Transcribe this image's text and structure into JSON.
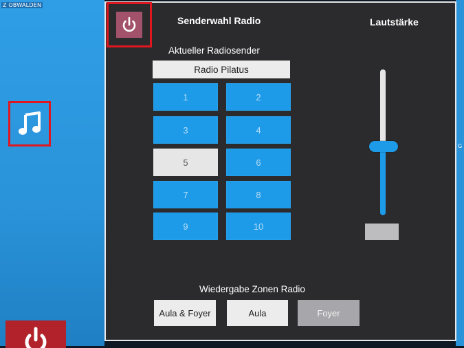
{
  "corner_label": "Z OBWALDEN",
  "right_edge_letter": "G",
  "left": {
    "music_icon": "music-note-icon",
    "power_icon": "power-icon"
  },
  "panel": {
    "title": "Senderwahl Radio",
    "volume_title": "Lautstärke",
    "current_station_label": "Aktueller Radiosender",
    "current_station": "Radio Pilatus",
    "zones_label": "Wiedergabe Zonen Radio"
  },
  "presets": [
    {
      "label": "1",
      "active": false
    },
    {
      "label": "2",
      "active": false
    },
    {
      "label": "3",
      "active": false
    },
    {
      "label": "4",
      "active": false
    },
    {
      "label": "5",
      "active": true
    },
    {
      "label": "6",
      "active": false
    },
    {
      "label": "7",
      "active": false
    },
    {
      "label": "8",
      "active": false
    },
    {
      "label": "9",
      "active": false
    },
    {
      "label": "10",
      "active": false
    }
  ],
  "zones": [
    {
      "label": "Aula & Foyer",
      "active": true
    },
    {
      "label": "Aula",
      "active": true
    },
    {
      "label": "Foyer",
      "active": false
    }
  ],
  "volume": {
    "level": 0.47
  },
  "colors": {
    "accent_blue": "#1d9be8",
    "panel_bg": "#2b2b2d",
    "power_button": "#a3526b",
    "highlight_red": "#e0171f"
  }
}
